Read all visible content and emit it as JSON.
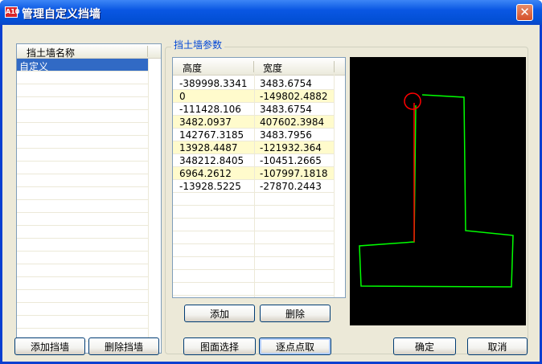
{
  "window": {
    "title": "管理自定义挡墙",
    "app_icon": "A10",
    "close_symbol": "✕"
  },
  "list": {
    "header": "挡土墙名称",
    "items": [
      "自定义"
    ],
    "selected_index": 0
  },
  "params": {
    "group_title": "挡土墙参数",
    "columns": [
      "高度",
      "宽度"
    ],
    "rows": [
      [
        "-389998.3341",
        "3483.6754"
      ],
      [
        "0",
        "-149802.4882"
      ],
      [
        "-111428.106",
        "3483.6754"
      ],
      [
        "3482.0937",
        "407602.3984"
      ],
      [
        "142767.3185",
        "3483.7956"
      ],
      [
        "13928.4487",
        "-121932.364"
      ],
      [
        "348212.8405",
        "-10451.2665"
      ],
      [
        "6964.2612",
        "-107997.1818"
      ],
      [
        "-13928.5225",
        "-27870.2443"
      ]
    ]
  },
  "buttons": {
    "add": "添加",
    "delete": "删除",
    "add_wall": "添加挡墙",
    "delete_wall": "删除挡墙",
    "pick_from_drawing": "图面选择",
    "pick_points": "逐点点取",
    "ok": "确定",
    "cancel": "取消"
  },
  "colors": {
    "titlebar": "#0a57e3",
    "selection": "#316ac5",
    "row_alt": "#fffbcc",
    "preview_bg": "#000000",
    "outline": "#00ff00",
    "axis": "#ff0000"
  }
}
